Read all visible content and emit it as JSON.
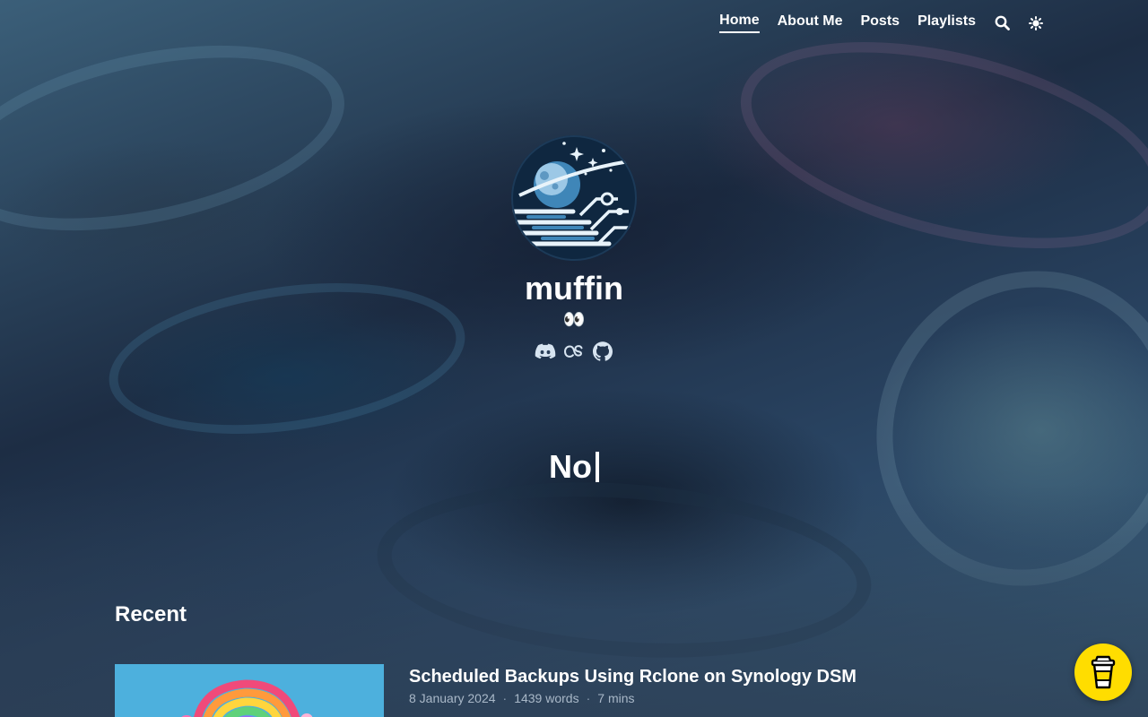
{
  "nav": {
    "items": [
      {
        "label": "Home",
        "active": true
      },
      {
        "label": "About Me",
        "active": false
      },
      {
        "label": "Posts",
        "active": false
      },
      {
        "label": "Playlists",
        "active": false
      }
    ],
    "icons": [
      "search-icon",
      "theme-toggle-icon"
    ]
  },
  "profile": {
    "name": "muffin",
    "tagline": "👀",
    "socials": [
      "discord-icon",
      "lastfm-icon",
      "github-icon"
    ]
  },
  "hero": {
    "typed_text": "No"
  },
  "recent": {
    "heading": "Recent",
    "posts": [
      {
        "title": "Scheduled Backups Using Rclone on Synology DSM",
        "date": "8 January 2024",
        "words": "1439 words",
        "read_time": "7 mins"
      }
    ]
  },
  "buy_me_a_coffee": {
    "icon": "coffee-cup-icon",
    "color": "#ffdd00"
  },
  "colors": {
    "text": "#ffffff",
    "meta": "#a9b8c8"
  }
}
